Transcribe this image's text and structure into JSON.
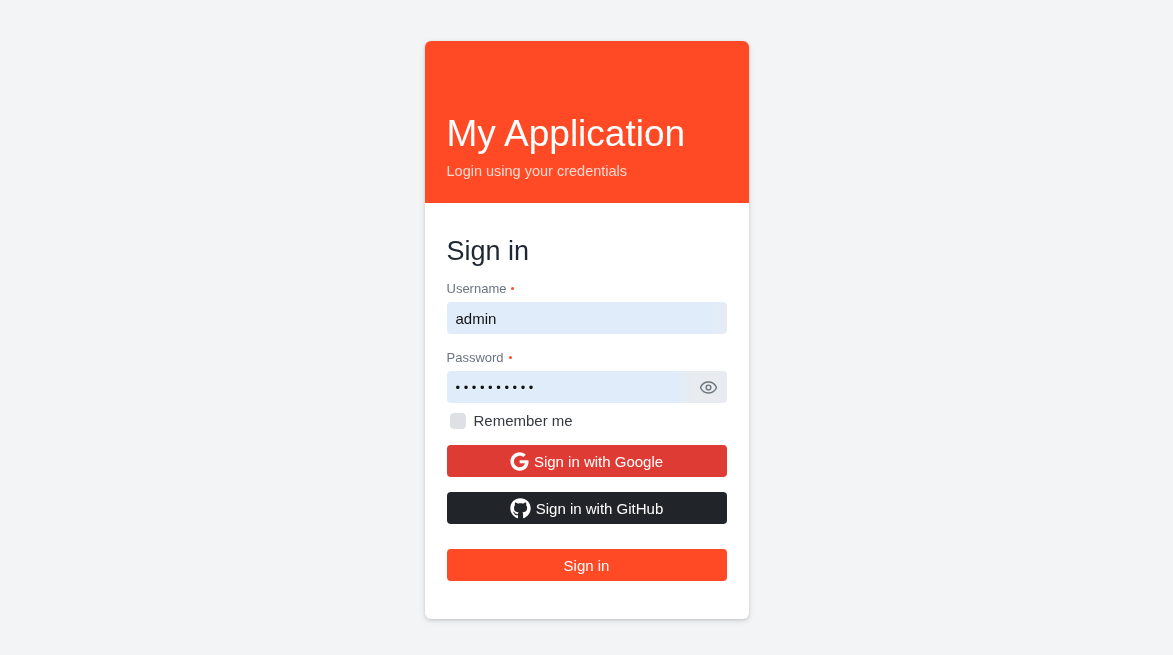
{
  "header": {
    "title": "My Application",
    "subtitle": "Login using your credentials"
  },
  "form": {
    "title": "Sign in",
    "fields": [
      {
        "kind": "text",
        "label": "Username",
        "required": true,
        "value": "admin"
      },
      {
        "kind": "password",
        "label": "Password",
        "required": true,
        "value": "••••••••••"
      }
    ],
    "remember": {
      "label": "Remember me",
      "checked": false
    },
    "buttons": [
      {
        "kind": "google",
        "label": "Sign in with Google"
      },
      {
        "kind": "github",
        "label": "Sign in with GitHub"
      },
      {
        "kind": "primary",
        "label": "Sign in"
      }
    ]
  }
}
